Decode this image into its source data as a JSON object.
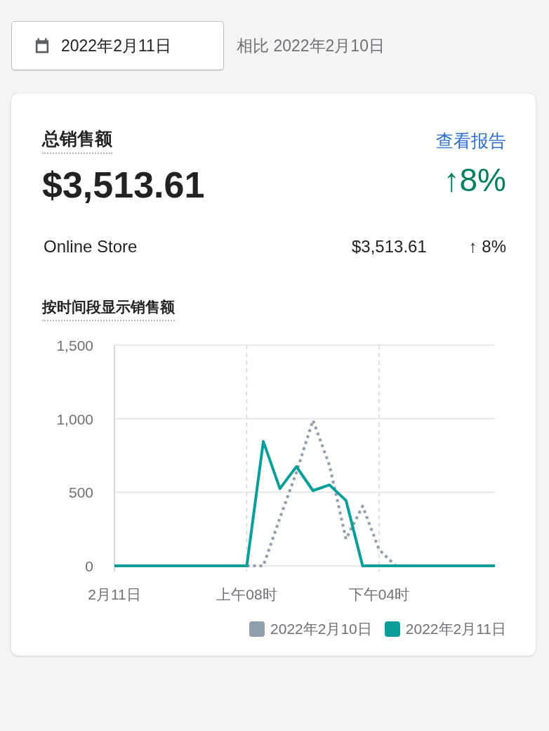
{
  "date_picker": {
    "value": "2022年2月11日",
    "comparison": "相比 2022年2月10日"
  },
  "card": {
    "title": "总销售额",
    "link": "查看报告",
    "total": "$3,513.61",
    "change": "↑8%",
    "channels": [
      {
        "name": "Online Store",
        "amount": "$3,513.61",
        "change": "↑ 8%"
      }
    ],
    "chart_title": "按时间段显示销售额",
    "chart_data": {
      "type": "line",
      "categories": [
        "2月11日",
        null,
        null,
        null,
        null,
        null,
        null,
        null,
        "上午08时",
        null,
        null,
        null,
        null,
        null,
        null,
        null,
        "下午04时",
        null,
        null,
        null,
        null,
        null,
        null,
        null
      ],
      "ylim": [
        0,
        1500
      ],
      "grid": true,
      "yticks": [
        {
          "value": 0,
          "label": "0"
        },
        {
          "value": 500,
          "label": "500"
        },
        {
          "value": 1000,
          "label": "1,000"
        },
        {
          "value": 1500,
          "label": "1,500"
        }
      ],
      "series": [
        {
          "name": "2022年2月10日",
          "color": "#919eab",
          "line_style": "dotted",
          "values": [
            null,
            null,
            null,
            null,
            null,
            null,
            null,
            null,
            0,
            0,
            325,
            635,
            989,
            683,
            182,
            406,
            110,
            0,
            null,
            null,
            null,
            null,
            null,
            null
          ]
        },
        {
          "name": "2022年2月11日",
          "color": "#0a9e9a",
          "line_style": "solid",
          "values": [
            0,
            0,
            0,
            0,
            0,
            0,
            0,
            0,
            0,
            845,
            525,
            674,
            511,
            550,
            444,
            0,
            0,
            0,
            0,
            0,
            0,
            0,
            0,
            0
          ]
        }
      ]
    }
  }
}
